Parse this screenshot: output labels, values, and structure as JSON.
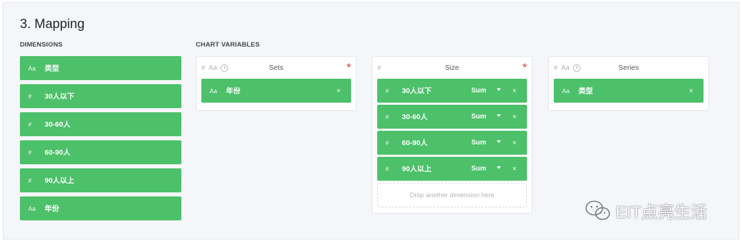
{
  "section_title": "3. Mapping",
  "dimensions_label": "DIMENSIONS",
  "chart_variables_label": "CHART VARIABLES",
  "dimensions": [
    {
      "type": "Aa",
      "label": "类型"
    },
    {
      "type": "#",
      "label": "30人以下"
    },
    {
      "type": "#",
      "label": "30-60人"
    },
    {
      "type": "#",
      "label": "60-90人"
    },
    {
      "type": "#",
      "label": "90人以上"
    },
    {
      "type": "Aa",
      "label": "年份"
    }
  ],
  "variables": {
    "sets": {
      "name": "Sets",
      "types": [
        "#",
        "Aa"
      ],
      "required": "*",
      "chips": [
        {
          "type": "Aa",
          "label": "年份",
          "remove": "×"
        }
      ]
    },
    "size": {
      "name": "Size",
      "types": [
        "#"
      ],
      "required": "*",
      "chips": [
        {
          "type": "#",
          "label": "30人以下",
          "agg": "Sum",
          "remove": "×"
        },
        {
          "type": "#",
          "label": "30-60人",
          "agg": "Sum",
          "remove": "×"
        },
        {
          "type": "#",
          "label": "60-90人",
          "agg": "Sum",
          "remove": "×"
        },
        {
          "type": "#",
          "label": "90人以上",
          "agg": "Sum",
          "remove": "×"
        }
      ],
      "drop_placeholder": "Drop another dimension here"
    },
    "series": {
      "name": "Series",
      "types": [
        "#",
        "Aa"
      ],
      "chips": [
        {
          "type": "Aa",
          "label": "类型",
          "remove": "×"
        }
      ]
    }
  },
  "watermark": "EIT点亮生活",
  "colors": {
    "chip": "#4dc06a",
    "required": "#e23b3b",
    "background": "#f4f6f9"
  }
}
